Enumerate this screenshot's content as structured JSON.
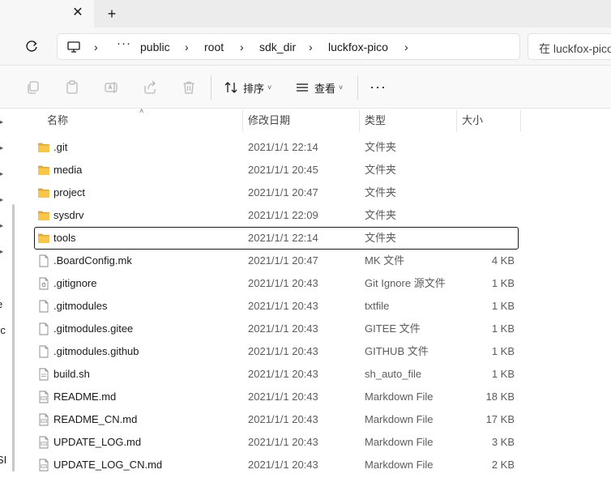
{
  "tabs": {
    "close_glyph": "✕",
    "new_glyph": "+"
  },
  "address": {
    "ellipsis": "···",
    "separator": "›",
    "crumbs": [
      "public",
      "root",
      "sdk_dir",
      "luckfox-pico"
    ],
    "search_placeholder": "在 luckfox-pico"
  },
  "commands": {
    "sort_label": "排序",
    "view_label": "查看",
    "more_glyph": "···",
    "chevron_glyph": "˅"
  },
  "navpane": {
    "clipped_labels": [
      "e",
      "rc",
      "SI"
    ]
  },
  "columns": {
    "name": "名称",
    "date": "修改日期",
    "type": "类型",
    "size": "大小",
    "sort_glyph": "˄"
  },
  "files": [
    {
      "name": ".git",
      "date": "2021/1/1 22:14",
      "type": "文件夹",
      "size": "",
      "icon": "folder-icon"
    },
    {
      "name": "media",
      "date": "2021/1/1 20:45",
      "type": "文件夹",
      "size": "",
      "icon": "folder-icon"
    },
    {
      "name": "project",
      "date": "2021/1/1 20:47",
      "type": "文件夹",
      "size": "",
      "icon": "folder-icon"
    },
    {
      "name": "sysdrv",
      "date": "2021/1/1 22:09",
      "type": "文件夹",
      "size": "",
      "icon": "folder-icon"
    },
    {
      "name": "tools",
      "date": "2021/1/1 22:14",
      "type": "文件夹",
      "size": "",
      "icon": "folder-icon",
      "focused": true
    },
    {
      "name": ".BoardConfig.mk",
      "date": "2021/1/1 20:47",
      "type": "MK 文件",
      "size": "4 KB",
      "icon": "file-icon"
    },
    {
      "name": ".gitignore",
      "date": "2021/1/1 20:43",
      "type": "Git Ignore 源文件",
      "size": "1 KB",
      "icon": "gear-file-icon"
    },
    {
      "name": ".gitmodules",
      "date": "2021/1/1 20:43",
      "type": "txtfile",
      "size": "1 KB",
      "icon": "file-icon"
    },
    {
      "name": ".gitmodules.gitee",
      "date": "2021/1/1 20:43",
      "type": "GITEE 文件",
      "size": "1 KB",
      "icon": "file-icon"
    },
    {
      "name": ".gitmodules.github",
      "date": "2021/1/1 20:43",
      "type": "GITHUB 文件",
      "size": "1 KB",
      "icon": "file-icon"
    },
    {
      "name": "build.sh",
      "date": "2021/1/1 20:43",
      "type": "sh_auto_file",
      "size": "1 KB",
      "icon": "script-file-icon"
    },
    {
      "name": "README.md",
      "date": "2021/1/1 20:43",
      "type": "Markdown File",
      "size": "18 KB",
      "icon": "markdown-file-icon"
    },
    {
      "name": "README_CN.md",
      "date": "2021/1/1 20:43",
      "type": "Markdown File",
      "size": "17 KB",
      "icon": "markdown-file-icon"
    },
    {
      "name": "UPDATE_LOG.md",
      "date": "2021/1/1 20:43",
      "type": "Markdown File",
      "size": "3 KB",
      "icon": "markdown-file-icon"
    },
    {
      "name": "UPDATE_LOG_CN.md",
      "date": "2021/1/1 20:43",
      "type": "Markdown File",
      "size": "2 KB",
      "icon": "markdown-file-icon"
    }
  ],
  "colors": {
    "folder": "#f8c74a",
    "folder_dark": "#e6a92b",
    "focus_border": "#1a1a1a",
    "muted_text": "#5c5c5c"
  }
}
